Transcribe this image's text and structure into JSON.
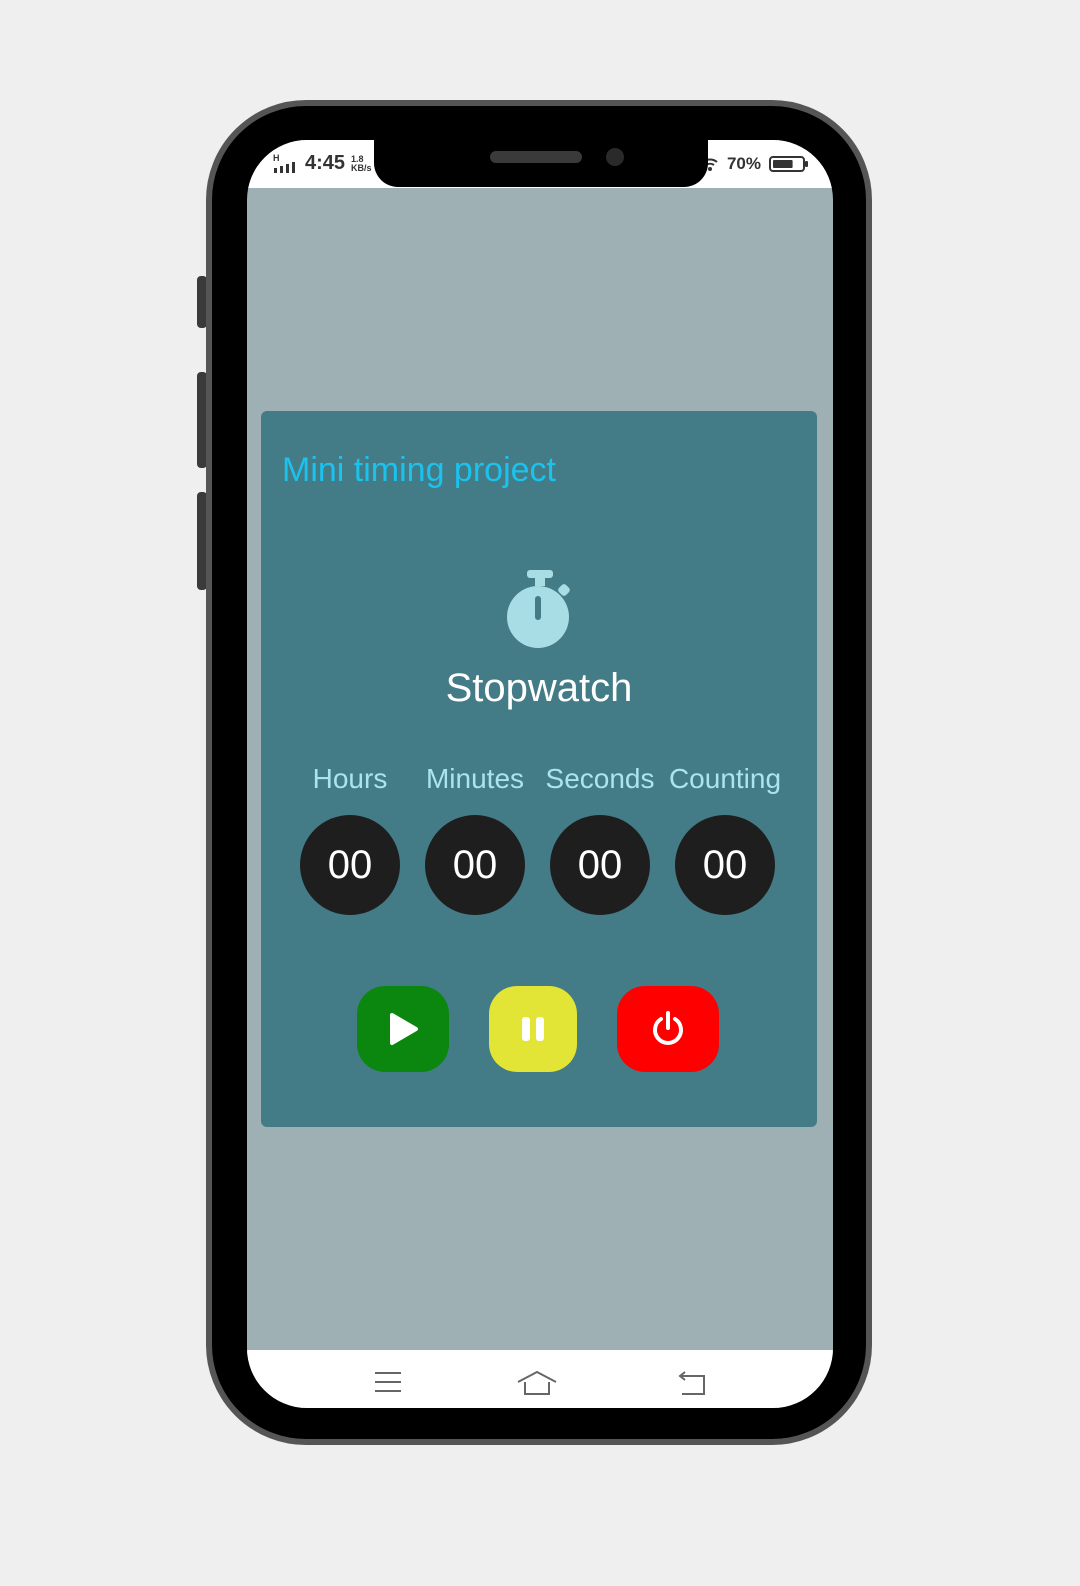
{
  "status_bar": {
    "network": "H",
    "time": "4:45",
    "speed_value": "1.8",
    "speed_unit": "KB/s",
    "battery_percent": "70%",
    "battery_level": 0.7
  },
  "app": {
    "title": "Mini timing project",
    "heading": "Stopwatch",
    "units": [
      {
        "label": "Hours",
        "value": "00"
      },
      {
        "label": "Minutes",
        "value": "00"
      },
      {
        "label": "Seconds",
        "value": "00"
      },
      {
        "label": "Counting",
        "value": "00"
      }
    ],
    "controls": [
      {
        "name": "start-button",
        "icon": "play-icon",
        "color": "#0b870f"
      },
      {
        "name": "pause-button",
        "icon": "pause-icon",
        "color": "#e2e535"
      },
      {
        "name": "reset-button",
        "icon": "power-icon",
        "color": "#ff0000"
      }
    ]
  },
  "colors": {
    "page_background": "#9fb0b4",
    "card_background": "#437b86",
    "title_color": "#1bc2ee",
    "unit_label_color": "#a9e4ef",
    "digit_background": "#1e1e1e"
  },
  "navigation": {
    "icons": [
      "menu-icon",
      "home-icon",
      "back-icon"
    ]
  }
}
